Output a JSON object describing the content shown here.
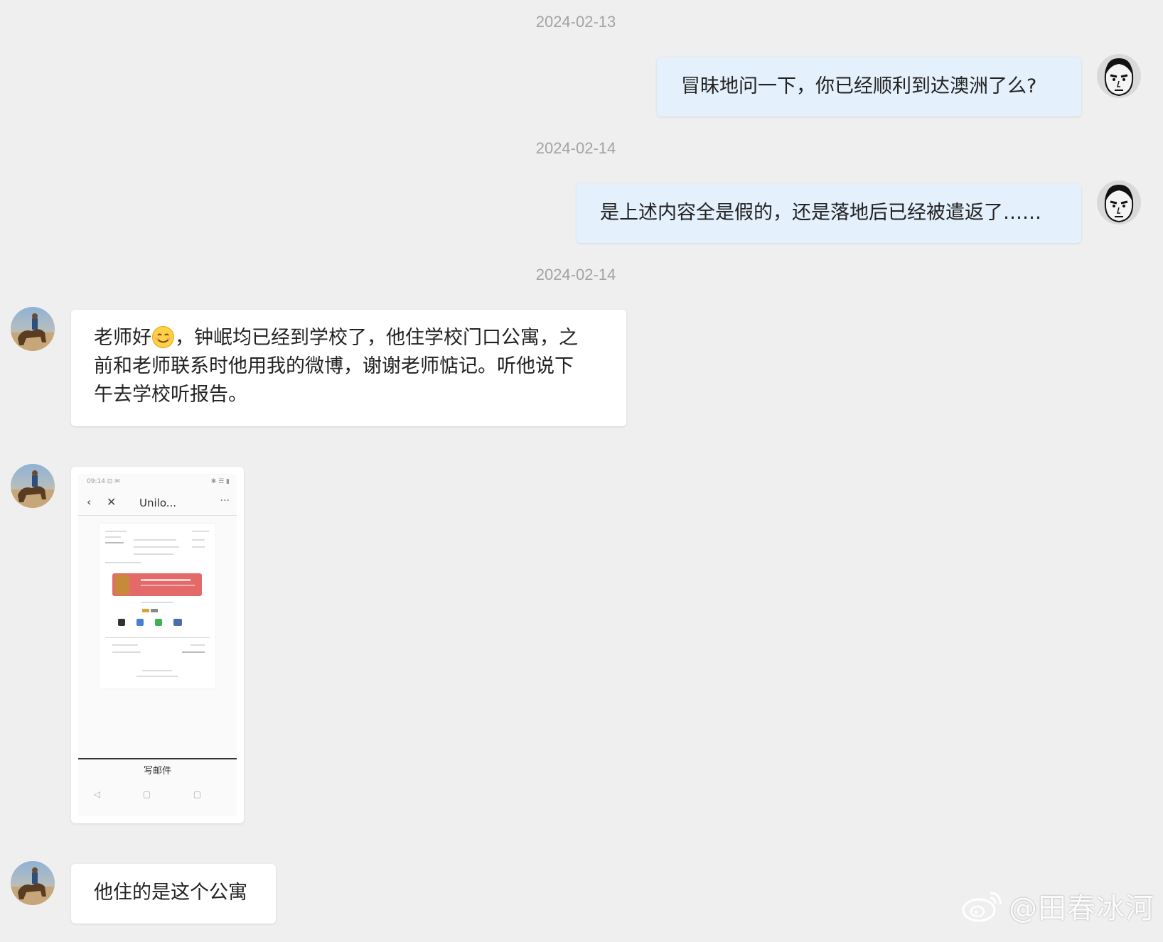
{
  "timestamps": [
    "2024-02-13",
    "2024-02-14",
    "2024-02-14"
  ],
  "messages": {
    "m1": "冒昧地问一下，你已经顺利到达澳洲了么?",
    "m2": "是上述内容全是假的，还是落地后已经被遣返了……",
    "m3_a": "老师好",
    "m3_b": "，钟岷均已经到学校了，他住学校门口公寓，之",
    "m3_c": "前和老师联系时他用我的微博，谢谢老师惦记。听他说下",
    "m3_d": "午去学校听报告。",
    "m5": "他住的是这个公寓"
  },
  "screenshot": {
    "status_left": "09:14 ⊡ ✉",
    "status_right": "✱ ☰ ▮",
    "back": "‹",
    "close": "✕",
    "title": "Unilo...",
    "more": "···",
    "compose_label": "写邮件",
    "sysnav": "◁ ▢ ▢"
  },
  "watermark": {
    "text": "@田春冰河",
    "icon": "weibo-logo-icon"
  },
  "colors": {
    "background": "#efefef",
    "outgoing_bubble": "#e4f0fb",
    "incoming_bubble": "#ffffff",
    "timestamp": "#a3a3a3"
  }
}
